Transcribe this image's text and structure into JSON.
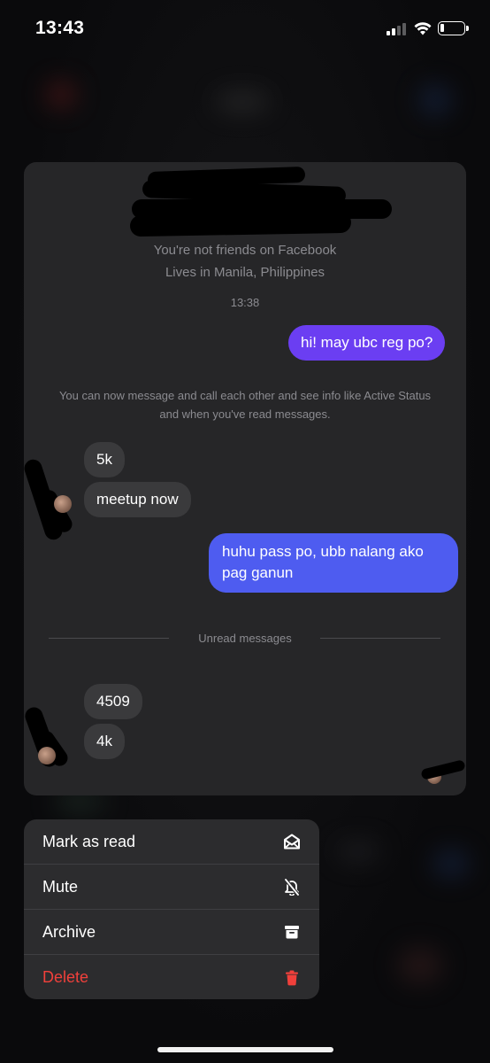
{
  "status_bar": {
    "time": "13:43"
  },
  "chat": {
    "profile": {
      "friend_status": "You're not friends on Facebook",
      "location": "Lives in Manila, Philippines"
    },
    "timestamp": "13:38",
    "messages": [
      {
        "direction": "outgoing",
        "text": "hi! may ubc reg po?"
      },
      {
        "direction": "incoming",
        "text": "5k"
      },
      {
        "direction": "incoming",
        "text": "meetup now"
      },
      {
        "direction": "outgoing",
        "text": "huhu pass po, ubb nalang ako pag ganun"
      },
      {
        "direction": "incoming",
        "text": "4509"
      },
      {
        "direction": "incoming",
        "text": "4k"
      }
    ],
    "system_note": "You can now message and call each other and see info like Active Status and when you've read messages.",
    "unread_divider": "Unread messages"
  },
  "context_menu": {
    "items": [
      {
        "label": "Mark as read",
        "icon": "envelope-open-icon"
      },
      {
        "label": "Mute",
        "icon": "bell-slash-icon"
      },
      {
        "label": "Archive",
        "icon": "archive-box-icon"
      },
      {
        "label": "Delete",
        "icon": "trash-icon"
      }
    ]
  },
  "colors": {
    "outgoing_bubble_top": "#6b3ef2",
    "outgoing_bubble_bottom": "#4e5cf0",
    "incoming_bubble": "#3a3a3c",
    "danger": "#f0403b"
  }
}
